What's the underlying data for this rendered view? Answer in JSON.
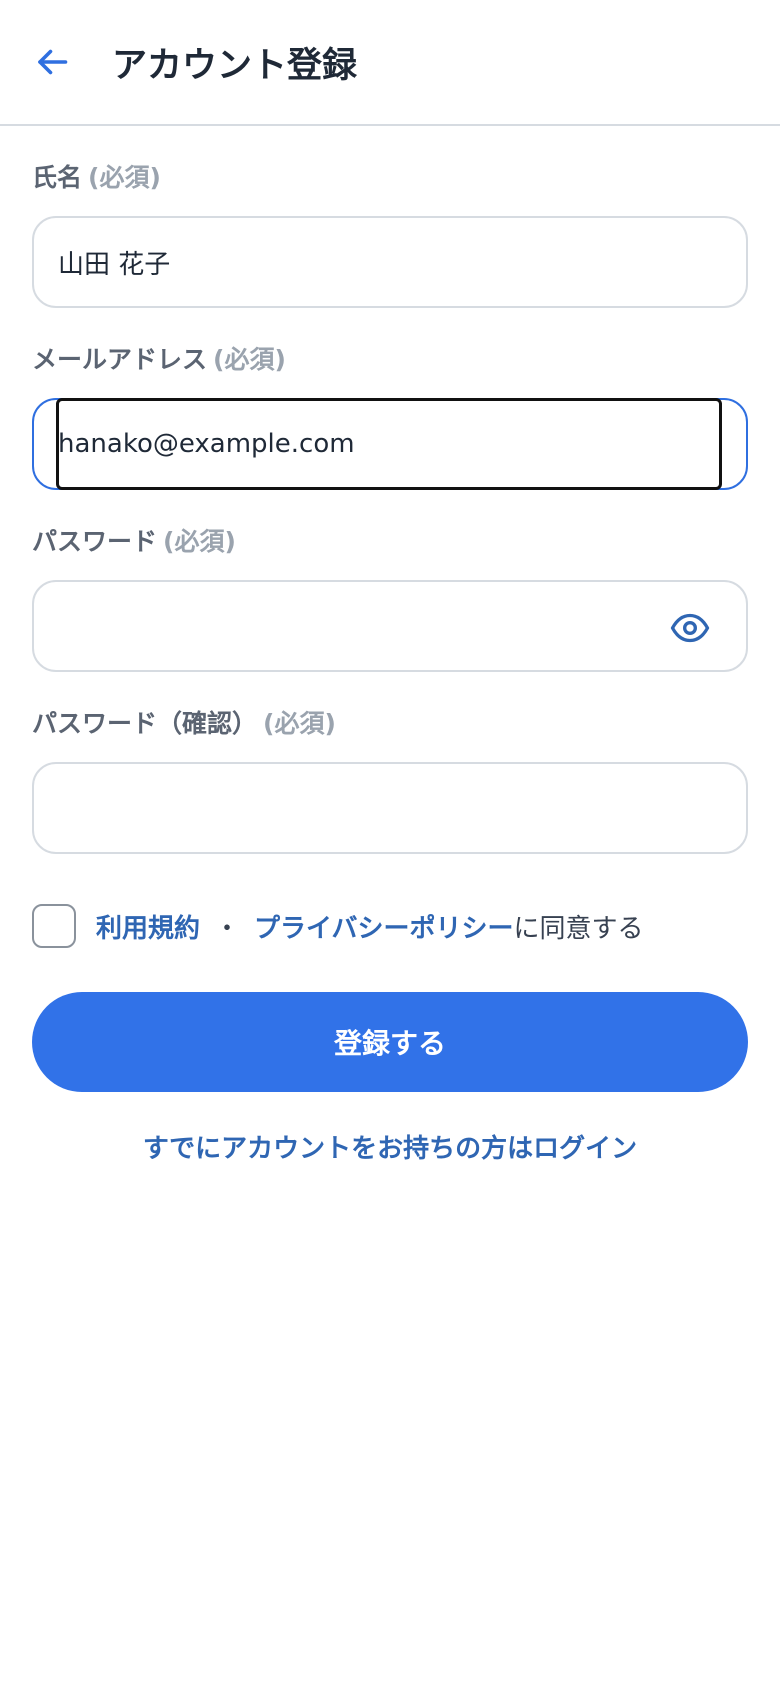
{
  "header": {
    "title": "アカウント登録",
    "back_icon": "arrow-left-icon"
  },
  "form": {
    "name": {
      "label": "氏名",
      "required": "(必須)",
      "value": "山田 花子"
    },
    "email": {
      "label": "メールアドレス",
      "required": "(必須)",
      "value": "hanako@example.com"
    },
    "password": {
      "label": "パスワード",
      "required": "(必須)",
      "value": "",
      "toggle_icon": "eye-icon"
    },
    "password_confirm": {
      "label": "パスワード（確認）",
      "required": "(必須)",
      "value": ""
    }
  },
  "agreement": {
    "terms_link": "利用規約",
    "separator": "・",
    "privacy_link": "プライバシーポリシー",
    "suffix": "に同意する",
    "checked": false
  },
  "submit_label": "登録する",
  "login_link": "すでにアカウントをお持ちの方はログイン",
  "colors": {
    "accent": "#3172e8",
    "link": "#2f66b3",
    "border": "#d6dbe1"
  }
}
